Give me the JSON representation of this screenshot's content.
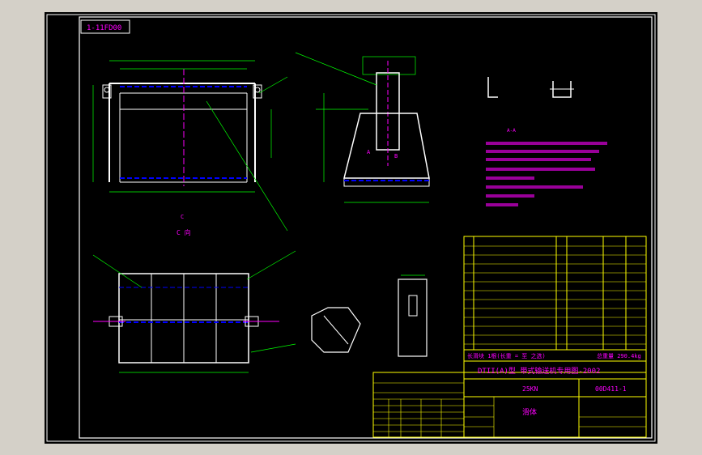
{
  "drawing": {
    "code_box": "1-11FD00",
    "main_title": "DTII(A)型 带式输送机专用图-2002",
    "spec": "25KN",
    "drawing_no": "00D411-1",
    "part_name": "滑体",
    "note_row": "长滑块 1根(长重 = 至 之选)",
    "weight": "总重量 290.4kg",
    "view_c": "C 向",
    "view_label_c": "C",
    "detail_label_a": "A",
    "detail_label_b": "B",
    "scale_label": "A-A"
  },
  "colors": {
    "frame": "#ffffff",
    "title_block": "#ffff00",
    "text": "#ff00ff",
    "hidden": "#0000ff",
    "dim": "#00ff00",
    "background": "#000000"
  }
}
